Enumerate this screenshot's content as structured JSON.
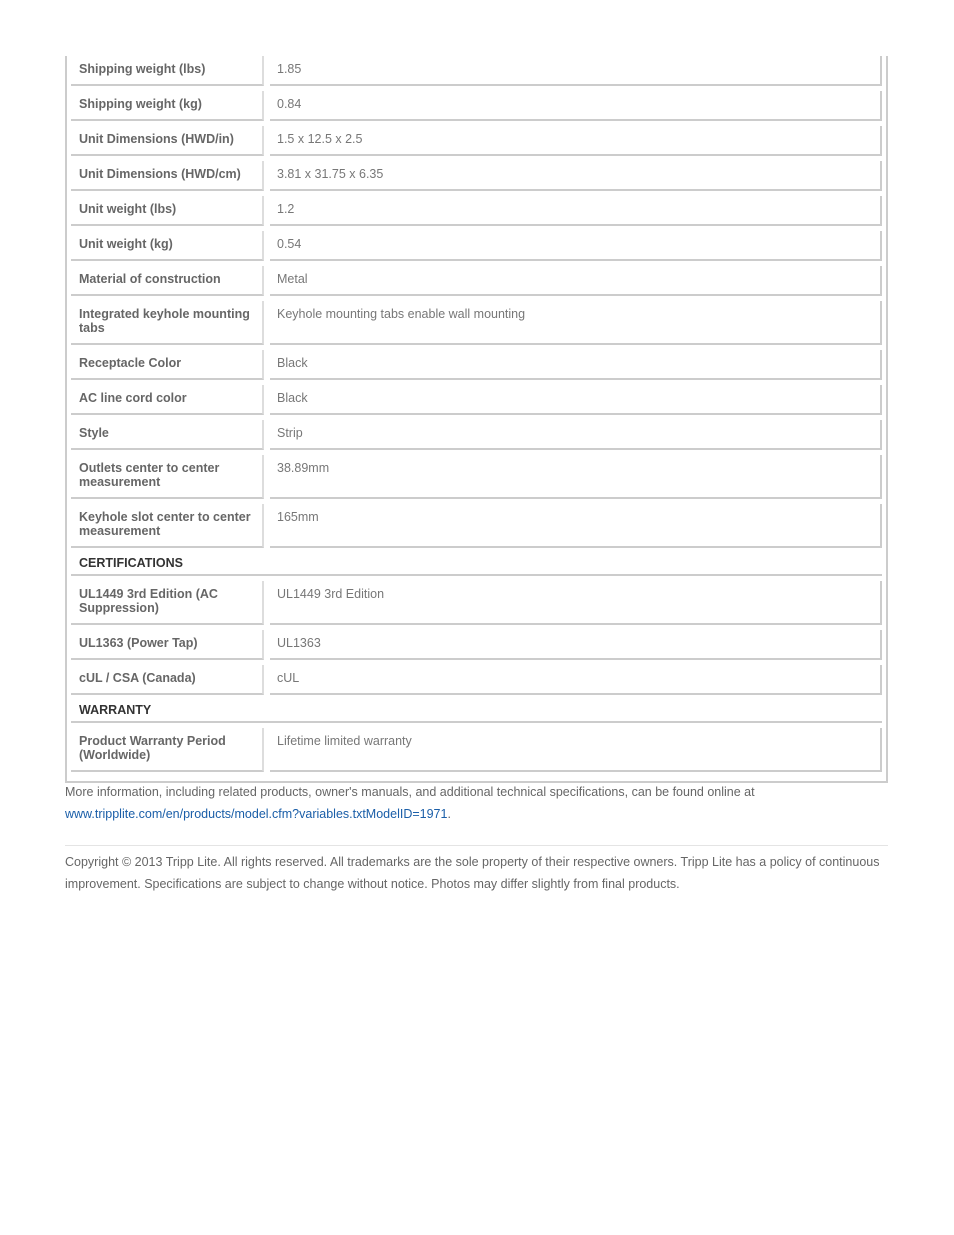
{
  "spec_rows": [
    {
      "type": "row",
      "label": "Shipping weight (lbs)",
      "value": "1.85"
    },
    {
      "type": "row",
      "label": "Shipping weight (kg)",
      "value": "0.84"
    },
    {
      "type": "row",
      "label": "Unit Dimensions (HWD/in)",
      "value": "1.5 x 12.5 x 2.5"
    },
    {
      "type": "row",
      "label": "Unit Dimensions (HWD/cm)",
      "value": "3.81 x 31.75 x 6.35"
    },
    {
      "type": "row",
      "label": "Unit weight (lbs)",
      "value": "1.2"
    },
    {
      "type": "row",
      "label": "Unit weight (kg)",
      "value": "0.54"
    },
    {
      "type": "row",
      "label": "Material of construction",
      "value": "Metal"
    },
    {
      "type": "row",
      "label": "Integrated keyhole mounting tabs",
      "value": "Keyhole mounting tabs enable wall mounting",
      "tall": true
    },
    {
      "type": "row",
      "label": "Receptacle Color",
      "value": "Black"
    },
    {
      "type": "row",
      "label": "AC line cord color",
      "value": "Black"
    },
    {
      "type": "row",
      "label": "Style",
      "value": "Strip"
    },
    {
      "type": "row",
      "label": "Outlets center to center measurement",
      "value": "38.89mm",
      "tall": true
    },
    {
      "type": "row",
      "label": "Keyhole slot center to center measurement",
      "value": "165mm",
      "tall": true
    },
    {
      "type": "section",
      "label": "CERTIFICATIONS"
    },
    {
      "type": "row",
      "label": "UL1449 3rd Edition (AC Suppression)",
      "value": "UL1449 3rd Edition",
      "tall": true
    },
    {
      "type": "row",
      "label": "UL1363 (Power Tap)",
      "value": "UL1363"
    },
    {
      "type": "row",
      "label": "cUL / CSA (Canada)",
      "value": "cUL"
    },
    {
      "type": "section",
      "label": "WARRANTY"
    },
    {
      "type": "row",
      "label": "Product Warranty Period (Worldwide)",
      "value": "Lifetime limited warranty",
      "tall": true
    }
  ],
  "more_info": {
    "text": "More information, including related products, owner's manuals, and additional technical specifications, can be found online at",
    "link": "www.tripplite.com/en/products/model.cfm?variables.txtModelID=1971",
    "link_suffix": "."
  },
  "copyright": "Copyright © 2013 Tripp Lite. All rights reserved. All trademarks are the sole property of their respective owners. Tripp Lite has a policy of continuous improvement. Specifications are subject to change without notice. Photos may differ slightly from final products.",
  "colors": {
    "link": "#1a5ea8",
    "border": "#cccccc",
    "text": "#666666"
  }
}
